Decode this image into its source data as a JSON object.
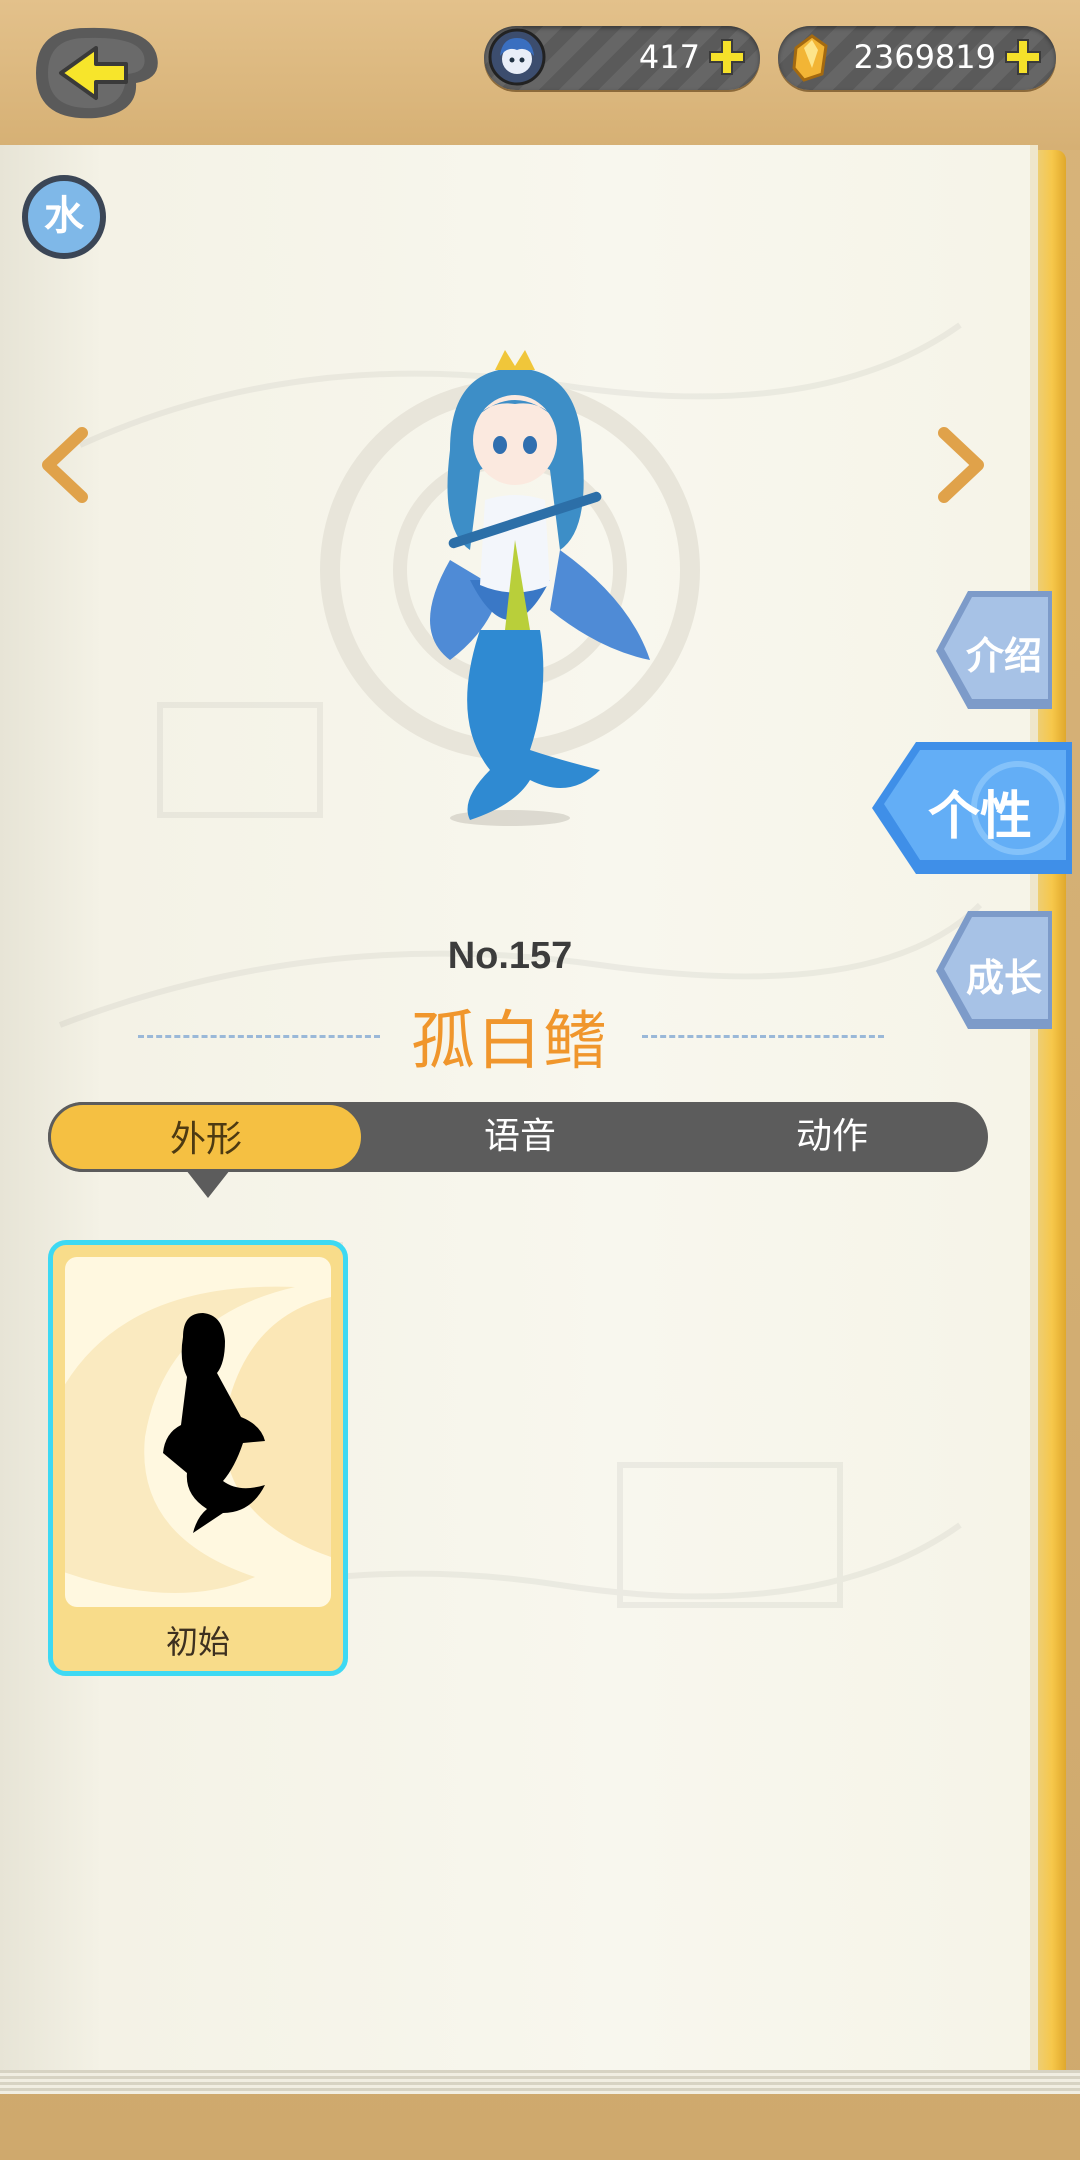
{
  "header": {
    "resources": [
      {
        "icon": "character-avatar-icon",
        "value": "417"
      },
      {
        "icon": "gold-crystal-icon",
        "value": "2369819"
      }
    ]
  },
  "element": {
    "label": "水",
    "color": "#7fb8e8"
  },
  "monster": {
    "number": "No.157",
    "name": "孤白鳍"
  },
  "tabs": [
    {
      "label": "外形",
      "active": true
    },
    {
      "label": "语音",
      "active": false
    },
    {
      "label": "动作",
      "active": false
    }
  ],
  "skins": [
    {
      "label": "初始",
      "selected": true
    }
  ],
  "side_tabs": [
    {
      "label": "介绍",
      "active": false
    },
    {
      "label": "个性",
      "active": true
    },
    {
      "label": "成长",
      "active": false
    }
  ],
  "colors": {
    "accent": "#f0962c",
    "tab_active": "#f5c042",
    "selected_border": "#3ed9f3"
  }
}
